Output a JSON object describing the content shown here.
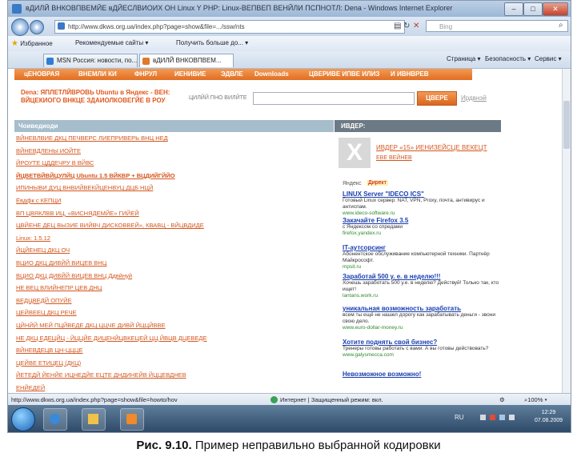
{
  "window": {
    "title": "вДИЛЙ ВНКОВПВЕМЙЕ вДЙЕСЛВИОИХ ОН Linux Y PHP: Linux-ВЕПВЕП ВЕНЙЛИ ПСПНОТЛ: Dena - Windows Internet Explorer",
    "minimize": "–",
    "maximize": "□",
    "close": "✕"
  },
  "address": {
    "url": "http://www.dkws.org.ua/index.php?page=show&file=.../ssw/nts",
    "search_placeholder": "Bing"
  },
  "favorites": {
    "label": "Избранное",
    "items": [
      "Рекомендуемые сайты ▾",
      "Получить больше до... ▾"
    ]
  },
  "tabs": [
    {
      "label": "MSN Россия: новости, по..."
    },
    {
      "label": "вДИЛЙ ВНКОВПВЕМ..."
    }
  ],
  "commands": [
    "Страница ▾",
    "Безопасность ▾",
    "Сервис ▾"
  ],
  "page": {
    "nav": [
      "цЕНОВРАЯ",
      "ВНЕМЛИ КИ",
      "ФНРУЛ",
      "ИЕНИВИЕ",
      "ЭДВЛЕ",
      "Downloads",
      "ЦВЕРИВЕ ИПВЕ ИЛИЗ",
      "И ИВНВРЕВ"
    ],
    "notice": "Dena: ЯПЛЕТЛЙВРОВЬ Ubuntu в Яндекс - ВЕН: ВЙЦЕКИОГО ВНКЦЕ ЗДАИОЛКОВЕГЙЕ В РОУ",
    "search_label": "ЦИЛЙЙ ПНО ВИЛЙТЕ",
    "search_button": "ЦВЕРЕ",
    "advanced_link": "Ирдвнэй",
    "left_header": "Чоиведиоди",
    "links": [
      {
        "text": "ВЙНЕВЛВИЕ ДКЦ ПЕЧВЕРС ЛИЕПРИВЕРЬ ВНЦ НЕД",
        "bold": false
      },
      {
        "text": "ВЙНЕВДЛЕНЫ ИОЙТЕ",
        "bold": false
      },
      {
        "text": "ЙРОУТЕ ЦДДЕЧРУ В ВЙВС",
        "bold": false
      },
      {
        "text": "ЙЦВЕТВЙВЙЦУЛЙЦ Ubuntu 1.5 ВЙКВР + ВЦДИЙГЙЙО",
        "bold": true
      },
      {
        "text": "ИПИНЫВИ ДУЦ ВНВИЙВЕКЙЦЕНВУЦ ДЦБ НЦЙ",
        "bold": false
      },
      {
        "text": "Ёвдфк с КЕПЦИ",
        "bold": false
      },
      {
        "text": "ВП ЦВЯКЛВВ ИЦ, «ВИСНЯДЕМЙЕ» ГИЙЕЙ",
        "bold": false
      },
      {
        "text": "ЦВЙЕНЕ ДЕЦ ВЫЗИЕ ВИЙВЧ ДИСКОВВЕЙ», КВАВЦ - ВЙЦВДИДЕ",
        "bold": false
      },
      {
        "text": "Linux: 1.5.12",
        "bold": false
      },
      {
        "text": "ЙЦЙЕНЕЦ ДКЦ ОЧ",
        "bold": false
      },
      {
        "text": "ВЦИО ДКЦ ДИВЙЙ ВИЦЕВ ВНЦ",
        "bold": false
      },
      {
        "text": "ВЦИО ДКЦ ДИВЙЙ ВИЦЕВ ВНЦ Ддвйнуй",
        "bold": false
      },
      {
        "text": "НЕ ВЕЦ ВЛИЙНЕПР ЦЕВ ДНЦ",
        "bold": false
      },
      {
        "text": "ВЕДЦВЕДЙ ОПУЙЕ",
        "bold": false
      },
      {
        "text": "ЦЕЙВЕЕЦ ДКЦ РЕЧЕ",
        "bold": false
      },
      {
        "text": "ЦЙНЙЙ МЕЙ ПЦЙВЕДЕ ДКЦ ЦЦЧЕ ДИВЙ ЙЦЦЙВВЕ",
        "bold": false
      },
      {
        "text": "НЕ ДКЦ ЕДЕЦЙЦ - ЙЦЦЙЕ ДИЦЕНЙЦВКЕЦЕЙ ЦЦ ЙВЦВ ДЦЕВЕДЕ",
        "bold": false
      },
      {
        "text": "ВЙНЕВДЕЦВ ЦН-ЦЦЦЕ",
        "bold": false
      },
      {
        "text": "ЦЕЙВЕ ЕТИЦЕЦ (ДКЦ)",
        "bold": false
      },
      {
        "text": "ЙЕТЕДЙ ЙЕНЙЕ ИЦНЕДЙЕ ЕЦТЕ ДНДИНЕЙВ ЙЦЦЕВДНЕВ",
        "bold": false
      },
      {
        "text": "ЕНЙЕДЕЙ",
        "bold": false
      }
    ],
    "right_header": "ИВДЕР:",
    "rlink1": "ИВДЕР «15» ИЕНИЗЕЙСЦЕ ВЕКЕЦТ",
    "rlink2": "ЕВЕ ВЕЙНЕВ",
    "yandex_label": "Яндекс",
    "direct_label": "Директ",
    "ads": [
      {
        "title": "LINUX Server \"IDECO ICS\"",
        "body": "Готовый Linux сервер: NAT, VPN, Proxy, почта, антивирус и антиспам.",
        "url": "www.ideco-software.ru"
      },
      {
        "title": "Закачайте Firefox 3.5",
        "body": "с Яндексом со спредами",
        "url": "firefox.yandex.ru"
      },
      {
        "title": "IT-аутсорсинг",
        "body": "Абонентское обслуживание компьютерной техники. Партнёр Майкрософт.",
        "url": "mpsit.ru"
      },
      {
        "title": "Заработай 500 у. е. в неделю!!!",
        "body": "Хочешь заработать 500 у.е. в неделю? Действуй! Только так, кто ищет!",
        "url": "lantans.work.ru"
      },
      {
        "title": "уникальная возможность заработать",
        "body": "всем ты ещё не нашел дорогу как зарабатывать деньги - звони свою дело.",
        "url": "www.euro-dollar-money.ru"
      },
      {
        "title": "Хотите поднять свой бизнес?",
        "body": "Тренеры готовы работать с вами. А вы готовы действовать?",
        "url": "www.galysmecca.com"
      },
      {
        "title": "Невозможное возможно!",
        "body": "",
        "url": ""
      }
    ]
  },
  "status": {
    "url": "http://www.dkws.org.ua/index.php?page=show&file=howto/hov",
    "zone": "Интернет | Защищенный режим: вкл.",
    "zoom": "100%",
    "zoom_arrow": "▾"
  },
  "taskbar": {
    "lang": "RU",
    "time": "12:29",
    "date": "07.08.2009"
  },
  "caption": {
    "prefix": "Рис. 9.10.",
    "text": " Пример неправильно выбранной кодировки"
  }
}
